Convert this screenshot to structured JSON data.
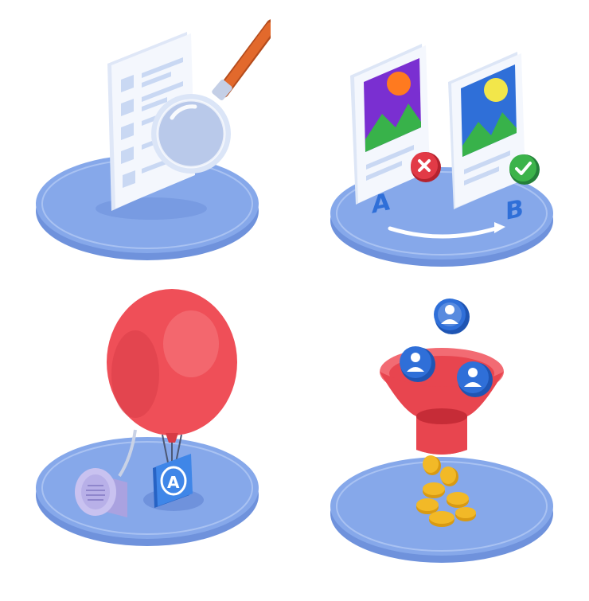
{
  "colors": {
    "platform_top": "#86a8ea",
    "platform_side": "#6f92dc",
    "platform_edge": "#a9c2f2",
    "paper": "#f4f7fd",
    "paper_lines": "#c9d8f3",
    "magnifier_handle": "#e2692c",
    "accent_blue": "#2f6fd8",
    "reject_red": "#e23a46",
    "accept_green": "#3cb34a",
    "balloon_red": "#ef4f58",
    "funnel_red": "#e8454f",
    "coin_gold": "#f2b927",
    "speaker_lavender": "#c9c2f0"
  },
  "scenes": {
    "document_search": {
      "icon": "magnifier-over-document-icon"
    },
    "ab_test": {
      "label_a": "A",
      "label_b": "B",
      "icon_reject": "cross-icon",
      "icon_accept": "check-icon"
    },
    "app_launch": {
      "app_badge_letter": "A",
      "icon": "balloon-icon"
    },
    "conversion_funnel": {
      "icon": "funnel-icon",
      "input": "user-avatar-icon",
      "output": "coin-icon"
    }
  }
}
